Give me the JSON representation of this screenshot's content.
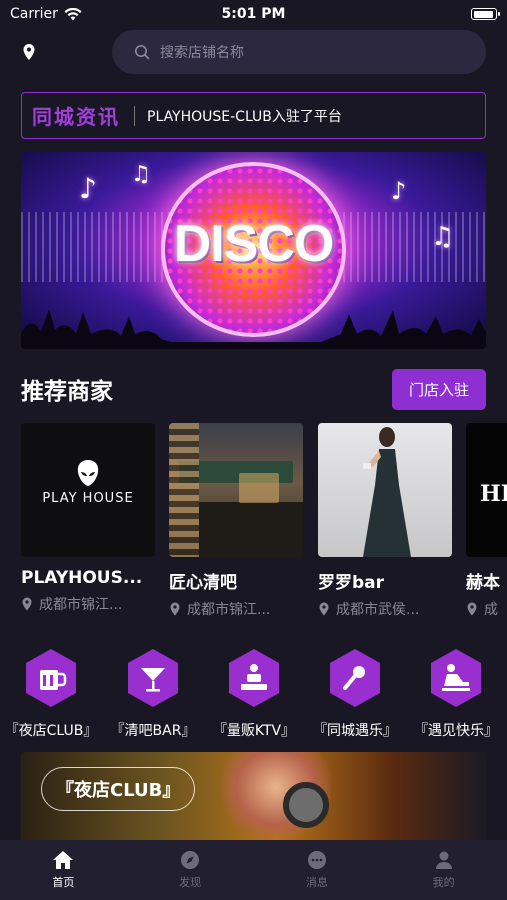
{
  "status_bar": {
    "carrier": "Carrier",
    "time": "5:01 PM"
  },
  "search": {
    "placeholder": "搜索店铺名称"
  },
  "news": {
    "title": "同城资讯",
    "text": "PLAYHOUSE-CLUB入驻了平台"
  },
  "banner": {
    "text": "DISCO"
  },
  "recommend": {
    "title": "推荐商家",
    "join_label": "门店入驻"
  },
  "merchants": [
    {
      "name": "PLAYHOUS...",
      "address": "成都市锦江...",
      "logo_text": "PLAY HOUSE"
    },
    {
      "name": "匠心清吧",
      "address": "成都市锦江..."
    },
    {
      "name": "罗罗bar",
      "address": "成都市武侯..."
    },
    {
      "name": "赫本",
      "address": "成",
      "logo_text": "HE"
    }
  ],
  "categories": [
    {
      "label": "『夜店CLUB』",
      "icon": "beer-mug-icon"
    },
    {
      "label": "『清吧BAR』",
      "icon": "cocktail-glass-icon"
    },
    {
      "label": "『量贩KTV』",
      "icon": "ktv-booth-icon"
    },
    {
      "label": "『同城遇乐』",
      "icon": "microphone-icon"
    },
    {
      "label": "『遇见快乐』",
      "icon": "massage-icon"
    }
  ],
  "promo": {
    "label": "『夜店CLUB』"
  },
  "tabs": [
    {
      "label": "首页",
      "icon": "home-icon",
      "active": true
    },
    {
      "label": "发现",
      "icon": "compass-icon",
      "active": false
    },
    {
      "label": "消息",
      "icon": "chat-icon",
      "active": false
    },
    {
      "label": "我的",
      "icon": "user-icon",
      "active": false
    }
  ],
  "colors": {
    "accent": "#8e2fd4",
    "background": "#1a1724",
    "muted_text": "#8a8694"
  }
}
